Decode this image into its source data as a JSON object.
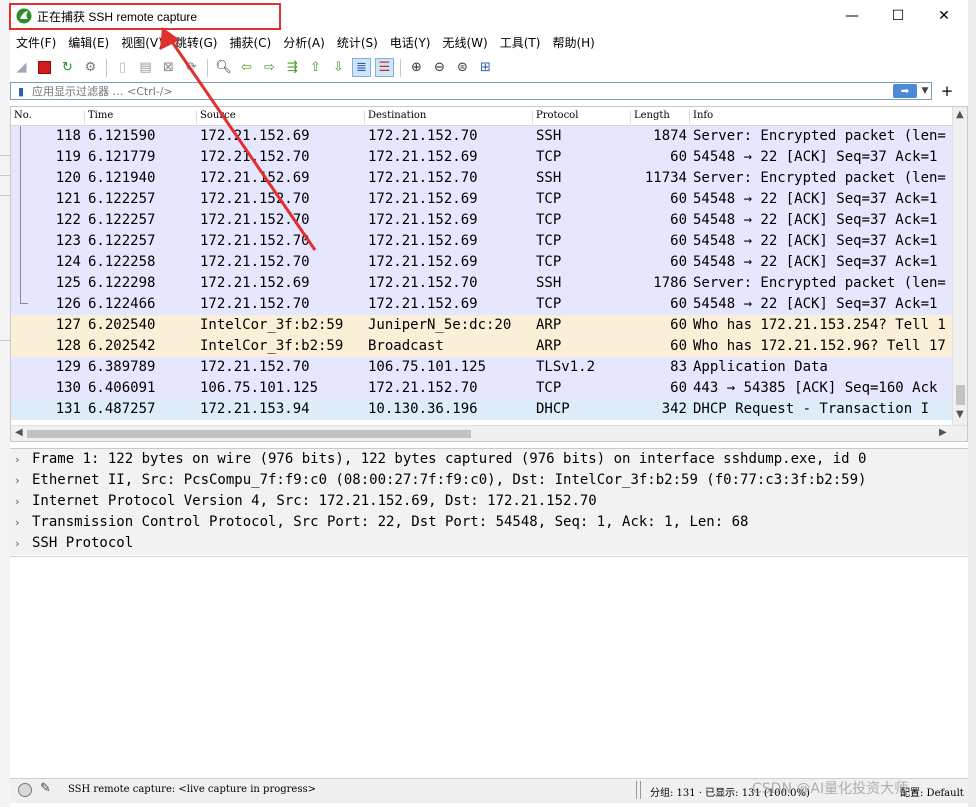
{
  "window": {
    "title": "正在捕获 SSH remote capture",
    "app_icon": "shark-fin-icon",
    "controls": {
      "minimize": "—",
      "maximize": "☐",
      "close": "✕"
    }
  },
  "menu": [
    "文件(F)",
    "编辑(E)",
    "视图(V)",
    "跳转(G)",
    "捕获(C)",
    "分析(A)",
    "统计(S)",
    "电话(Y)",
    "无线(W)",
    "工具(T)",
    "帮助(H)"
  ],
  "toolbar": {
    "icons": [
      "shark-start-icon",
      "stop-icon",
      "restart-icon",
      "options-icon",
      "open-icon",
      "save-icon",
      "close-file-icon",
      "reload-icon",
      "find-icon",
      "back-icon",
      "forward-icon",
      "goto-icon",
      "first-icon",
      "last-icon",
      "autoscroll-icon",
      "colorize-icon",
      "zoom-in-icon",
      "zoom-out-icon",
      "zoom-normal-icon",
      "resize-columns-icon"
    ]
  },
  "filter": {
    "placeholder": "应用显示过滤器 … <Ctrl-/>",
    "apply_icon": "arrow-right-icon",
    "add_label": "+"
  },
  "packet_list": {
    "columns": [
      "No.",
      "Time",
      "Source",
      "Destination",
      "Protocol",
      "Length",
      "Info"
    ],
    "rows": [
      {
        "no": "118",
        "time": "6.121590",
        "src": "172.21.152.69",
        "dst": "172.21.152.70",
        "proto": "SSH",
        "len": "1874",
        "info": "Server: Encrypted packet (len=",
        "color": "tcp"
      },
      {
        "no": "119",
        "time": "6.121779",
        "src": "172.21.152.70",
        "dst": "172.21.152.69",
        "proto": "TCP",
        "len": "60",
        "info": "54548 → 22 [ACK] Seq=37 Ack=1",
        "color": "tcp"
      },
      {
        "no": "120",
        "time": "6.121940",
        "src": "172.21.152.69",
        "dst": "172.21.152.70",
        "proto": "SSH",
        "len": "11734",
        "info": "Server: Encrypted packet (len=",
        "color": "tcp"
      },
      {
        "no": "121",
        "time": "6.122257",
        "src": "172.21.152.70",
        "dst": "172.21.152.69",
        "proto": "TCP",
        "len": "60",
        "info": "54548 → 22 [ACK] Seq=37 Ack=1",
        "color": "tcp"
      },
      {
        "no": "122",
        "time": "6.122257",
        "src": "172.21.152.70",
        "dst": "172.21.152.69",
        "proto": "TCP",
        "len": "60",
        "info": "54548 → 22 [ACK] Seq=37 Ack=1",
        "color": "tcp"
      },
      {
        "no": "123",
        "time": "6.122257",
        "src": "172.21.152.70",
        "dst": "172.21.152.69",
        "proto": "TCP",
        "len": "60",
        "info": "54548 → 22 [ACK] Seq=37 Ack=1",
        "color": "tcp"
      },
      {
        "no": "124",
        "time": "6.122258",
        "src": "172.21.152.70",
        "dst": "172.21.152.69",
        "proto": "TCP",
        "len": "60",
        "info": "54548 → 22 [ACK] Seq=37 Ack=1",
        "color": "tcp"
      },
      {
        "no": "125",
        "time": "6.122298",
        "src": "172.21.152.69",
        "dst": "172.21.152.70",
        "proto": "SSH",
        "len": "1786",
        "info": "Server: Encrypted packet (len=",
        "color": "tcp"
      },
      {
        "no": "126",
        "time": "6.122466",
        "src": "172.21.152.70",
        "dst": "172.21.152.69",
        "proto": "TCP",
        "len": "60",
        "info": "54548 → 22 [ACK] Seq=37 Ack=1",
        "color": "tcp"
      },
      {
        "no": "127",
        "time": "6.202540",
        "src": "IntelCor_3f:b2:59",
        "dst": "JuniperN_5e:dc:20",
        "proto": "ARP",
        "len": "60",
        "info": "Who has 172.21.153.254? Tell 1",
        "color": "arp"
      },
      {
        "no": "128",
        "time": "6.202542",
        "src": "IntelCor_3f:b2:59",
        "dst": "Broadcast",
        "proto": "ARP",
        "len": "60",
        "info": "Who has 172.21.152.96? Tell 17",
        "color": "arp"
      },
      {
        "no": "129",
        "time": "6.389789",
        "src": "172.21.152.70",
        "dst": "106.75.101.125",
        "proto": "TLSv1.2",
        "len": "83",
        "info": "Application Data",
        "color": "tcp"
      },
      {
        "no": "130",
        "time": "6.406091",
        "src": "106.75.101.125",
        "dst": "172.21.152.70",
        "proto": "TCP",
        "len": "60",
        "info": "443 → 54385 [ACK] Seq=160 Ack",
        "color": "tcp"
      },
      {
        "no": "131",
        "time": "6.487257",
        "src": "172.21.153.94",
        "dst": "10.130.36.196",
        "proto": "DHCP",
        "len": "342",
        "info": "DHCP Request  - Transaction I",
        "color": "sel"
      }
    ]
  },
  "details": [
    "Frame 1: 122 bytes on wire (976 bits), 122 bytes captured (976 bits) on interface sshdump.exe, id 0",
    "Ethernet II, Src: PcsCompu_7f:f9:c0 (08:00:27:7f:f9:c0), Dst: IntelCor_3f:b2:59 (f0:77:c3:3f:b2:59)",
    "Internet Protocol Version 4, Src: 172.21.152.69, Dst: 172.21.152.70",
    "Transmission Control Protocol, Src Port: 22, Dst Port: 54548, Seq: 1, Ack: 1, Len: 68",
    "SSH Protocol"
  ],
  "status": {
    "capture_text": "SSH remote capture: <live capture in progress>",
    "packets_text": "分组: 131 · 已显示: 131 (100.0%)",
    "profile": "配置: Default"
  },
  "watermark": "CSDN @AI量化投资大师",
  "colors": {
    "row_tcp": "#e7e6ff",
    "row_arp": "#faf0d7",
    "row_selected": "#dcecf9",
    "annotation_red": "#e03030"
  }
}
